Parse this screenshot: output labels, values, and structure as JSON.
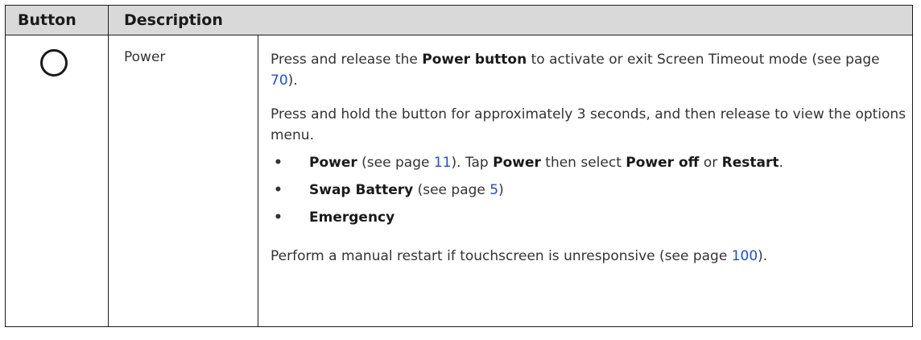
{
  "header": {
    "col1": "Button",
    "col2": "Description"
  },
  "row": {
    "name": "Power",
    "icon": "power-button-circle-icon",
    "p1": {
      "t1": "Press and release the ",
      "b1": "Power button",
      "t2": " to activate or exit Screen Timeout mode (see page ",
      "link": "70",
      "t3": ")."
    },
    "p2": "Press and hold the button for approximately 3 seconds, and then release to view the options menu.",
    "bullets": [
      {
        "dot": "•",
        "b1": "Power",
        "t1": " (see page ",
        "link": "11",
        "t2": "). Tap ",
        "b2": "Power",
        "t3": " then select ",
        "b3": "Power off",
        "t4": " or ",
        "b4": "Restart",
        "t5": "."
      },
      {
        "dot": "•",
        "b1": "Swap Battery",
        "t1": " (see page ",
        "link": "5",
        "t2": ")"
      },
      {
        "dot": "•",
        "b1": "Emergency"
      }
    ],
    "p3": {
      "t1": "Perform a manual restart if touchscreen is unresponsive (see page ",
      "link": "100",
      "t2": ")."
    }
  },
  "colors": {
    "header_bg": "#d9d9d9",
    "link": "#1a4fd6",
    "border": "#1a1a1a"
  }
}
